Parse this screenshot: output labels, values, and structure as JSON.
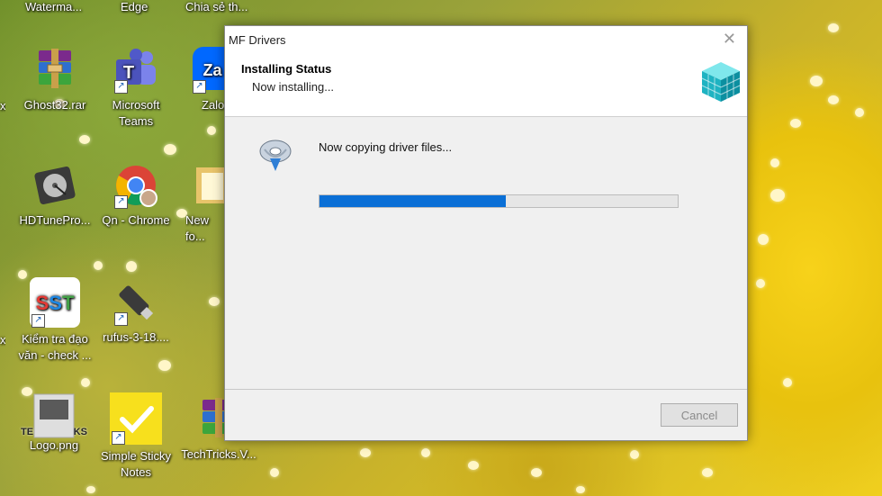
{
  "top_labels": [
    "Waterma...",
    "Edge",
    "Chia sẻ th..."
  ],
  "desktop_icons": [
    {
      "label": "Ghost32.rar",
      "icon": "winrar-archive-icon"
    },
    {
      "label": "Microsoft Teams",
      "icon": "teams-icon"
    },
    {
      "label": "Zalo",
      "icon": "zalo-icon"
    },
    {
      "label": "HDTunePro...",
      "icon": "hard-disk-icon"
    },
    {
      "label": "Qn - Chrome",
      "icon": "chrome-icon"
    },
    {
      "label": "New fo...",
      "icon": "folder-icon"
    },
    {
      "label": "Kiểm tra đạo văn - check ...",
      "icon": "sst-icon",
      "badge": "SST"
    },
    {
      "label": "rufus-3-18....",
      "icon": "usb-drive-icon"
    },
    {
      "label": "Simple Sticky Notes",
      "icon": "sticky-notes-icon"
    },
    {
      "label": "TechTricks.V...",
      "icon": "winrar-archive-icon"
    },
    {
      "label": "Logo.png",
      "icon": "image-file-icon",
      "badge": "TECH TRICKS"
    }
  ],
  "dialog": {
    "title": "MF Drivers",
    "close_glyph": "✕",
    "header_title": "Installing Status",
    "header_subtitle": "Now installing...",
    "message": "Now copying driver files...",
    "progress_percent": 52,
    "cancel_label": "Cancel",
    "progress_color": "#0a6fd6"
  }
}
